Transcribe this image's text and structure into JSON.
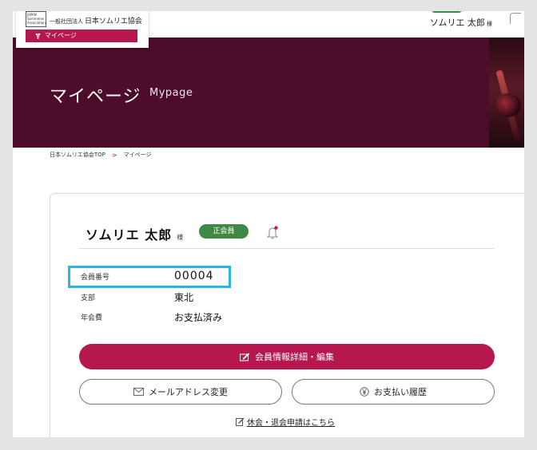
{
  "header": {
    "logo_emblem_text": "JAPAN Sommelier Association",
    "logo_prefix": "一般社団法人",
    "logo_name": "日本ソムリエ協会",
    "mypage_tab": "マイページ",
    "user_name": "ソムリエ 太郎",
    "user_suffix": "様"
  },
  "banner": {
    "title": "マイページ",
    "subtitle": "Mypage"
  },
  "breadcrumb": {
    "home": "日本ソムリエ協会TOP",
    "separator": ">",
    "current": "マイページ"
  },
  "profile": {
    "name": "ソムリエ 太郎",
    "suffix": "様",
    "status_badge": "正会員",
    "fields": [
      {
        "label": "会員番号",
        "value": "00004"
      },
      {
        "label": "支部",
        "value": "東北"
      },
      {
        "label": "年会費",
        "value": "お支払済み"
      }
    ]
  },
  "actions": {
    "edit_member_info": "会員情報詳細・編集",
    "change_email": "メールアドレス変更",
    "payment_history": "お支払い履歴",
    "leave_request": "休会・退会申請はこちら"
  },
  "colors": {
    "accent": "#b5174e",
    "banner": "#4d0c2a",
    "badge_green": "#3e8a45",
    "highlight": "#2bb4e6"
  }
}
